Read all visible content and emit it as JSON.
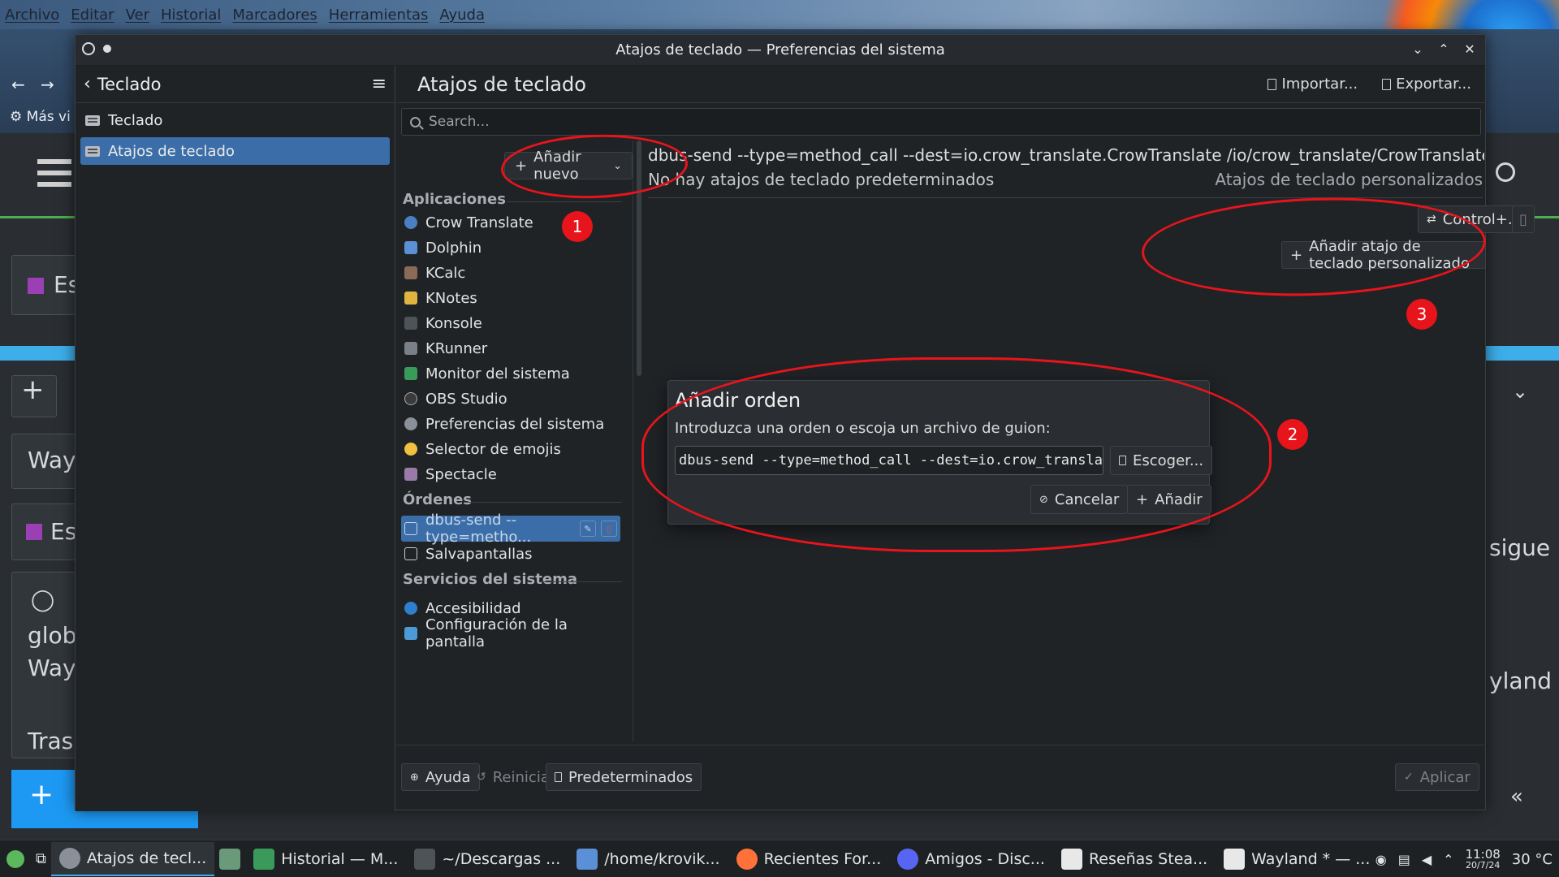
{
  "firefox": {
    "menu": [
      "Archivo",
      "Editar",
      "Ver",
      "Historial",
      "Marcadores",
      "Herramientas",
      "Ayuda"
    ],
    "toolbar_text": "Más vi",
    "bg_texts": [
      "Es",
      "Way",
      "Es",
      "glob",
      "Way",
      "Tras",
      "sigue",
      "yland"
    ]
  },
  "window": {
    "title": "Atajos de teclado — Preferencias del sistema"
  },
  "left_pane": {
    "header": "Teclado",
    "items": [
      "Teclado",
      "Atajos de teclado"
    ]
  },
  "right_pane": {
    "header": "Atajos de teclado",
    "import_label": "Importar...",
    "export_label": "Exportar...",
    "search_placeholder": "Search...",
    "add_new_label": "Añadir nuevo"
  },
  "list": {
    "sections": {
      "apps": "Aplicaciones",
      "commands": "Órdenes",
      "services": "Servicios del sistema"
    },
    "apps": [
      "Crow Translate",
      "Dolphin",
      "KCalc",
      "KNotes",
      "Konsole",
      "KRunner",
      "Monitor del sistema",
      "OBS Studio",
      "Preferencias del sistema",
      "Selector de emojis",
      "Spectacle"
    ],
    "commands": [
      "dbus-send --type=metho...",
      "Salvapantallas"
    ],
    "services": [
      "Accesibilidad",
      "Configuración de la pantalla"
    ]
  },
  "detail": {
    "command": "dbus-send --type=method_call --dest=io.crow_translate.CrowTranslate /io/crow_translate/CrowTranslate",
    "no_default": "No hay atajos de teclado predeterminados",
    "custom_label": "Atajos de teclado personalizados",
    "shortcut_label": "Control+.",
    "add_custom_label": "Añadir atajo de teclado personalizado"
  },
  "dialog": {
    "title": "Añadir orden",
    "subtitle": "Introduzca una orden o escoja un archivo de guion:",
    "input_value": "dbus-send --type=method_call --dest=io.crow_translate",
    "choose_label": "Escoger...",
    "cancel_label": "Cancelar",
    "add_label": "Añadir"
  },
  "bottom": {
    "help": "Ayuda",
    "reset": "Reiniciar",
    "defaults": "Predeterminados",
    "apply": "Aplicar"
  },
  "annotations": [
    "1",
    "2",
    "3"
  ],
  "taskbar": {
    "tasks": [
      "Atajos de tecl...",
      "Historial — M...",
      "~/Descargas ...",
      "/home/krovik...",
      "Recientes For...",
      "Amigos - Disc...",
      "Reseñas Stea...",
      "Wayland * — ..."
    ],
    "time": "11:08",
    "date": "20/7/24",
    "temp": "30 °C"
  },
  "colors": {
    "accent": "#3b6ea8",
    "annotation": "#e8141c"
  }
}
